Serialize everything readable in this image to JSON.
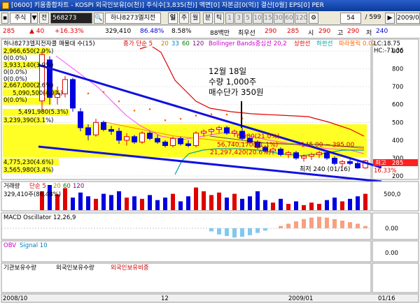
{
  "window": {
    "title": "[0600] 키움종합차트 - KOSPI 외국인보유[0(천)] 주식수[3,835(천)] 액면[0] 자본금[0(억)] 결산[0월] EPS[0] PER"
  },
  "toolbar": {
    "type_select": "주식",
    "type_arrow": "▼",
    "prev_label": "전",
    "code_value": "568273",
    "search_label": "🔍",
    "name_value": "하나8273엘지전",
    "period_day": "일",
    "period_week": "주",
    "period_month": "월",
    "period_tick": "분",
    "period_sec": "틱",
    "tick_nums": [
      "1",
      "3",
      "5",
      "10",
      "15",
      "30",
      "60",
      "120"
    ],
    "count_value": "54",
    "page_readout": "/ 599",
    "date_value": "2009/0"
  },
  "quote": {
    "price": "285",
    "change": "▲ 40",
    "change_pct": "+16.33%",
    "volume": "329,410",
    "volume_ratio": "86.48%",
    "turnover": "8.58%",
    "amount": "88백만",
    "min_label": "최우선",
    "min_val1": "290",
    "min_val2": "285",
    "open_label": "시",
    "open_val": "290",
    "high_label": "고",
    "high_val": "290",
    "low_label": "저",
    "low_val": "240"
  },
  "price_panel": {
    "legend_name": "하나8273엘지전자콜 매물대 수(15)",
    "legend_ma": "종가 단순 5",
    "ma_periods": [
      "20",
      "33",
      "60",
      "120"
    ],
    "legend_bb": "Bollinger Bands중심선 20,2",
    "legend_bb_up": "상한선",
    "legend_bb_dn": "하한선",
    "legend_psar": "파라볼릭 0.02",
    "lc_readout": "LC:18.75",
    "hc_readout": "HC:-71.36",
    "annotation": [
      "12월 18일",
      "수량 1,000주",
      "매수단가 350원"
    ],
    "overlay_vp_top": "6,580(21.0%)",
    "overlay_vp_mid": "56,740,170(21.1%)",
    "overlay_vp_range": "145.00 ~ 395.00",
    "overlay_vp_low": "21,297,420(20.6%)",
    "low_label": "최저 240 (01/16)",
    "current_tag": "285",
    "current_pct": "16.33%",
    "current_label": "최고",
    "y_ticks": [
      "900",
      "800",
      "700",
      "600",
      "500",
      "400",
      "300",
      "200"
    ],
    "volume_profile": [
      "2,966,650(2.9%)",
      "0(0.0%)",
      "3,933,140(3.9%)",
      "0(0.0%)",
      "0(0.0%)",
      "2,667,000(2.6%)",
      "5,090,500(4.9%)",
      "0(0.0%)",
      "5,491,980(5.3%)",
      "3,239,390(3.1%)",
      "4,775,230(4.6%)",
      "3,565,980(3.4%)"
    ]
  },
  "volume_panel": {
    "legend_name": "거래량",
    "legend_ma": "단순 5",
    "ma_periods": [
      "20",
      "60",
      "120"
    ],
    "readout": "329,410주(86.48%)",
    "y_tick": "500,0"
  },
  "macd_panel": {
    "legend": "MACD Oscillator 12,26,9",
    "y_tick": "0.00"
  },
  "obv_panel": {
    "legend_name": "OBV",
    "legend_signal": "Signal 10",
    "y_tick": "0.00"
  },
  "inv_panel": {
    "legend_a": "기관보유수량",
    "legend_b": "외국인보유수량",
    "legend_c": "외국인보유비중"
  },
  "x_axis": {
    "labels": [
      "2008/10",
      "12",
      "2009/01",
      "01/16"
    ]
  },
  "chart_data": {
    "type": "candlestick",
    "candles": [
      {
        "o": 620,
        "h": 900,
        "l": 560,
        "c": 880
      },
      {
        "o": 850,
        "h": 870,
        "l": 600,
        "c": 640
      },
      {
        "o": 640,
        "h": 700,
        "l": 600,
        "c": 660
      },
      {
        "o": 660,
        "h": 760,
        "l": 640,
        "c": 740
      },
      {
        "o": 740,
        "h": 750,
        "l": 560,
        "c": 580
      },
      {
        "o": 560,
        "h": 580,
        "l": 450,
        "c": 470
      },
      {
        "o": 470,
        "h": 490,
        "l": 400,
        "c": 430
      },
      {
        "o": 430,
        "h": 520,
        "l": 420,
        "c": 500
      },
      {
        "o": 500,
        "h": 510,
        "l": 450,
        "c": 460
      },
      {
        "o": 460,
        "h": 480,
        "l": 430,
        "c": 450
      },
      {
        "o": 450,
        "h": 470,
        "l": 380,
        "c": 400
      },
      {
        "o": 400,
        "h": 440,
        "l": 370,
        "c": 420
      },
      {
        "o": 420,
        "h": 430,
        "l": 380,
        "c": 390
      },
      {
        "o": 390,
        "h": 450,
        "l": 380,
        "c": 440
      },
      {
        "o": 440,
        "h": 450,
        "l": 400,
        "c": 410
      },
      {
        "o": 410,
        "h": 430,
        "l": 380,
        "c": 390
      },
      {
        "o": 390,
        "h": 400,
        "l": 360,
        "c": 370
      },
      {
        "o": 370,
        "h": 420,
        "l": 360,
        "c": 410
      },
      {
        "o": 410,
        "h": 420,
        "l": 370,
        "c": 380
      },
      {
        "o": 380,
        "h": 400,
        "l": 360,
        "c": 370
      },
      {
        "o": 370,
        "h": 450,
        "l": 360,
        "c": 440
      },
      {
        "o": 440,
        "h": 460,
        "l": 420,
        "c": 450
      },
      {
        "o": 450,
        "h": 470,
        "l": 430,
        "c": 460
      },
      {
        "o": 460,
        "h": 480,
        "l": 440,
        "c": 470
      },
      {
        "o": 470,
        "h": 480,
        "l": 430,
        "c": 440
      },
      {
        "o": 440,
        "h": 460,
        "l": 420,
        "c": 450
      },
      {
        "o": 450,
        "h": 470,
        "l": 400,
        "c": 410
      },
      {
        "o": 410,
        "h": 420,
        "l": 380,
        "c": 390
      },
      {
        "o": 390,
        "h": 400,
        "l": 350,
        "c": 360
      },
      {
        "o": 360,
        "h": 370,
        "l": 330,
        "c": 340
      },
      {
        "o": 340,
        "h": 360,
        "l": 320,
        "c": 350
      },
      {
        "o": 350,
        "h": 360,
        "l": 310,
        "c": 320
      },
      {
        "o": 320,
        "h": 340,
        "l": 300,
        "c": 330
      },
      {
        "o": 330,
        "h": 340,
        "l": 290,
        "c": 300
      },
      {
        "o": 300,
        "h": 320,
        "l": 280,
        "c": 310
      },
      {
        "o": 310,
        "h": 330,
        "l": 290,
        "c": 320
      },
      {
        "o": 320,
        "h": 340,
        "l": 300,
        "c": 330
      },
      {
        "o": 330,
        "h": 340,
        "l": 290,
        "c": 300
      },
      {
        "o": 300,
        "h": 310,
        "l": 260,
        "c": 270
      },
      {
        "o": 270,
        "h": 290,
        "l": 250,
        "c": 280
      },
      {
        "o": 280,
        "h": 300,
        "l": 260,
        "c": 270
      },
      {
        "o": 270,
        "h": 280,
        "l": 240,
        "c": 245
      },
      {
        "o": 245,
        "h": 290,
        "l": 240,
        "c": 285
      }
    ],
    "volume": [
      30,
      40,
      25,
      35,
      20,
      28,
      22,
      18,
      26,
      24,
      30,
      20,
      22,
      18,
      24,
      16,
      20,
      26,
      14,
      22,
      36,
      30,
      24,
      28,
      20,
      26,
      18,
      22,
      30,
      16,
      12,
      18,
      10,
      14,
      8,
      12,
      10,
      16,
      20,
      14,
      18,
      22,
      26
    ],
    "macd": [
      0,
      0,
      0,
      0,
      0,
      0,
      0,
      0,
      0,
      0,
      0,
      0,
      0,
      0,
      0,
      0,
      0,
      0,
      0,
      0,
      0,
      0,
      -4,
      -8,
      -10,
      -12,
      -11,
      -9,
      -6,
      -3,
      0,
      3,
      6,
      9,
      12,
      14,
      15,
      14,
      12,
      10,
      8,
      6,
      3
    ]
  }
}
